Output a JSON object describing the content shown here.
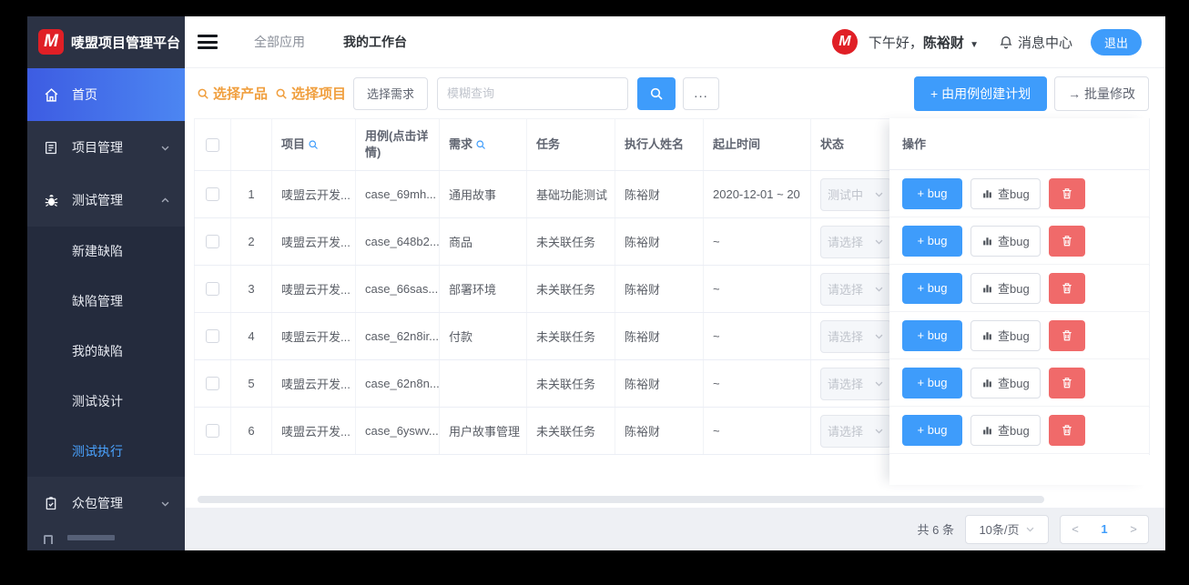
{
  "header": {
    "logo_letter": "M",
    "logo_title": "唛盟项目管理平台",
    "nav": {
      "all_apps": "全部应用",
      "my_workbench": "我的工作台"
    },
    "avatar_letter": "M",
    "greeting_prefix": "下午好，",
    "username": "陈裕财",
    "caret": "▼",
    "message_center": "消息中心",
    "logout": "退出"
  },
  "sidebar": {
    "home": "首页",
    "project_mgmt": "项目管理",
    "test_mgmt": "测试管理",
    "crowd_mgmt": "众包管理",
    "submenu": [
      {
        "label": "新建缺陷",
        "active": false
      },
      {
        "label": "缺陷管理",
        "active": false
      },
      {
        "label": "我的缺陷",
        "active": false
      },
      {
        "label": "测试设计",
        "active": false
      },
      {
        "label": "测试执行",
        "active": true
      }
    ]
  },
  "toolbar": {
    "select_product": "选择产品",
    "select_project": "选择项目",
    "select_requirement": "选择需求",
    "search_placeholder": "模糊查询",
    "more": "...",
    "create_plan_plus": "+",
    "create_plan": "由用例创建计划",
    "batch_arrow": "→",
    "batch_edit": "批量修改"
  },
  "table": {
    "headers": {
      "project": "项目",
      "case": "用例(点击详情)",
      "requirement": "需求",
      "task": "任务",
      "executor": "执行人姓名",
      "time": "起止时间",
      "status": "状态",
      "actions": "操作"
    },
    "rows": [
      {
        "index": "1",
        "project": "唛盟云开发...",
        "case": "case_69mh...",
        "requirement": "通用故事",
        "task": "基础功能测试",
        "executor": "陈裕财",
        "time": "2020-12-01 ~ 20",
        "status": "测试中"
      },
      {
        "index": "2",
        "project": "唛盟云开发...",
        "case": "case_648b2...",
        "requirement": "商品",
        "task": "未关联任务",
        "executor": "陈裕财",
        "time": "~",
        "status": "请选择"
      },
      {
        "index": "3",
        "project": "唛盟云开发...",
        "case": "case_66sas...",
        "requirement": "部署环境",
        "task": "未关联任务",
        "executor": "陈裕财",
        "time": "~",
        "status": "请选择"
      },
      {
        "index": "4",
        "project": "唛盟云开发...",
        "case": "case_62n8ir...",
        "requirement": "付款",
        "task": "未关联任务",
        "executor": "陈裕财",
        "time": "~",
        "status": "请选择"
      },
      {
        "index": "5",
        "project": "唛盟云开发...",
        "case": "case_62n8n...",
        "requirement": "",
        "task": "未关联任务",
        "executor": "陈裕财",
        "time": "~",
        "status": "请选择"
      },
      {
        "index": "6",
        "project": "唛盟云开发...",
        "case": "case_6yswv...",
        "requirement": "用户故事管理",
        "task": "未关联任务",
        "executor": "陈裕财",
        "time": "~",
        "status": "请选择"
      }
    ]
  },
  "row_actions": {
    "add_bug": "+ bug",
    "view_bug": "查bug"
  },
  "pagination": {
    "total": "共 6 条",
    "page_size": "10条/页",
    "prev": "<",
    "current": "1",
    "next": ">"
  },
  "colors": {
    "primary": "#3e9cfb",
    "danger": "#f06a6a",
    "warning_orange": "#f09f3f",
    "sidebar_bg": "#2b3244",
    "active_gradient_start": "#3d5ce2",
    "active_gradient_end": "#4c86f2"
  }
}
